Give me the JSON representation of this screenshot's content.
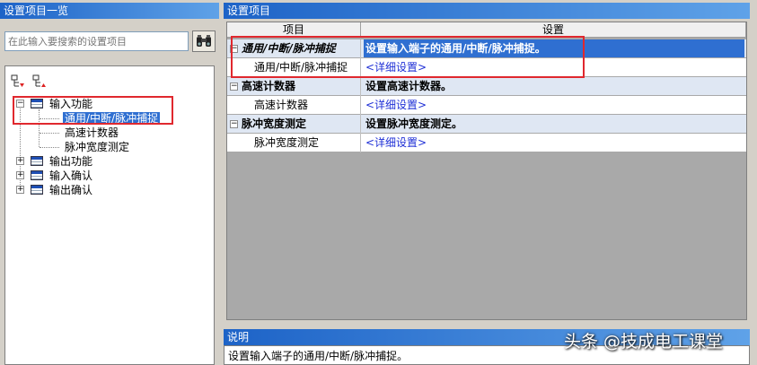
{
  "left": {
    "title": "设置项目一览",
    "search_placeholder": "在此输入要搜索的设置项目",
    "tree": [
      {
        "label": "输入功能",
        "expanded": true,
        "children": [
          {
            "label": "通用/中断/脉冲捕捉",
            "selected": true
          },
          {
            "label": "高速计数器"
          },
          {
            "label": "脉冲宽度测定"
          }
        ]
      },
      {
        "label": "输出功能",
        "expanded": false
      },
      {
        "label": "输入确认",
        "expanded": false
      },
      {
        "label": "输出确认",
        "expanded": false
      }
    ]
  },
  "right": {
    "title": "设置项目",
    "headers": {
      "item": "项目",
      "setting": "设置"
    },
    "groups": [
      {
        "name": "通用/中断/脉冲捕捉",
        "desc": "设置输入端子的通用/中断/脉冲捕捉。",
        "sub_name": "通用/中断/脉冲捕捉",
        "link": "<详细设置>"
      },
      {
        "name": "高速计数器",
        "desc": "设置高速计数器。",
        "sub_name": "高速计数器",
        "link": "<详细设置>"
      },
      {
        "name": "脉冲宽度测定",
        "desc": "设置脉冲宽度测定。",
        "sub_name": "脉冲宽度测定",
        "link": "<详细设置>"
      }
    ]
  },
  "description": {
    "title": "说明",
    "text": "设置输入端子的通用/中断/脉冲捕捉。"
  },
  "watermark": "头条 @技成电工课堂",
  "colors": {
    "title_bar": "#1d63c7",
    "selection": "#2f6fd1",
    "highlight_box": "#e0282e",
    "link": "#1e2fd6"
  }
}
